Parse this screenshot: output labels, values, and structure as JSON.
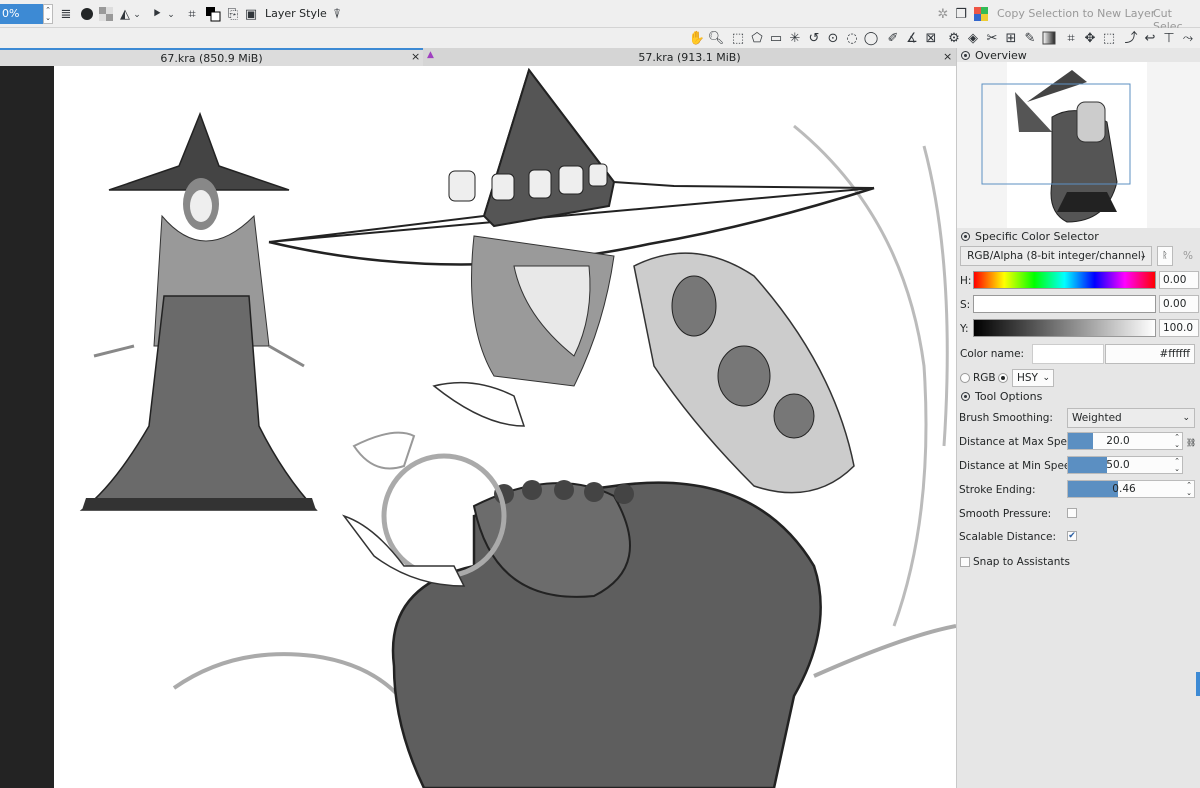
{
  "toolbar": {
    "zoom_value": "0%",
    "layer_style_label": "Layer Style",
    "copy_selection_label": "Copy Selection to New Layer",
    "cut_selection_label": "Cut Selec"
  },
  "tabs": [
    {
      "title": "67.kra (850.9 MiB)",
      "close": "×"
    },
    {
      "title": "57.kra (913.1 MiB)",
      "close": "×"
    }
  ],
  "overview": {
    "title": "Overview"
  },
  "color_selector": {
    "title": "Specific Color Selector",
    "color_space": "RGB/Alpha (8-bit integer/channel)",
    "percent_label": "%",
    "h_label": "H:",
    "h_value": "0.00",
    "s_label": "S:",
    "s_value": "0.00",
    "y_label": "Y:",
    "y_value": "100.0",
    "color_name_label": "Color name:",
    "color_name_value": "#ffffff",
    "radio_rgb": "RGB",
    "radio_hsy": "HSY",
    "colors": {
      "accent": "#5b8fc2",
      "selection": "#3d8ad4"
    }
  },
  "tool_options": {
    "title": "Tool Options",
    "brush_smoothing_label": "Brush Smoothing:",
    "brush_smoothing_value": "Weighted",
    "max_speed_label": "Distance at Max Speed:",
    "max_speed_value": "20.0",
    "max_speed_fraction": 0.22,
    "min_speed_label": "Distance at Min Speed:",
    "min_speed_value": "50.0",
    "min_speed_fraction": 0.34,
    "stroke_ending_label": "Stroke Ending:",
    "stroke_ending_value": "0.46",
    "stroke_ending_fraction": 0.4,
    "smooth_pressure_label": "Smooth Pressure:",
    "smooth_pressure_checked": false,
    "scalable_distance_label": "Scalable Distance:",
    "scalable_distance_checked": true,
    "snap_label": "Snap to Assistants",
    "snap_checked": false
  },
  "icons": [
    "grab-hand-icon",
    "zoom-icon",
    "rect-select-icon",
    "polygon-select-icon",
    "outline-select-icon",
    "contiguous-select-icon",
    "bezier-select-icon",
    "similar-select-icon",
    "ellipse-select-icon",
    "assistant-icon",
    "measure-icon",
    "reference-icon",
    "fill-icon",
    "pattern-fill-icon",
    "picker-icon",
    "gradient-icon",
    "crop-icon",
    "move-icon",
    "transform-icon",
    "smart-patch-icon",
    "bezier-curve-icon",
    "freehand-path-icon",
    "multibrush-icon"
  ]
}
